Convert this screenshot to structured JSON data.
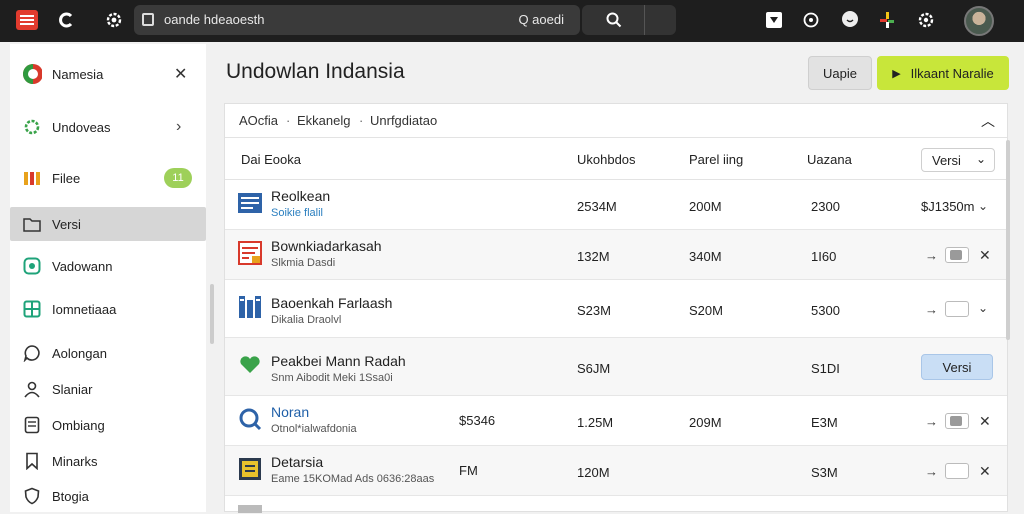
{
  "topbar": {
    "url_text": "oande hdeaoesth",
    "search_text": "Q aoedi",
    "icons": [
      "menu-icon",
      "refresh-icon",
      "gear-icon",
      "tab-icon",
      "search-icon",
      "download-icon",
      "whatsapp-icon",
      "emoji-icon",
      "pinwheel-icon",
      "settings-icon",
      "avatar"
    ]
  },
  "sidebar": {
    "header": "Namesia",
    "items": [
      {
        "label": "Undoveas",
        "icon": "gear-green-icon"
      },
      {
        "label": "Filee",
        "icon": "files-icon",
        "badge": "11"
      },
      {
        "label": "Versi",
        "icon": "folder-icon",
        "active": true
      },
      {
        "label": "Vadowann",
        "icon": "record-icon"
      },
      {
        "label": "Iomnetiaaa",
        "icon": "grid-icon"
      },
      {
        "label": "Aolongan",
        "icon": "chat-icon"
      },
      {
        "label": "Slaniar",
        "icon": "person-icon"
      },
      {
        "label": "Ombiang",
        "icon": "doc-icon"
      },
      {
        "label": "Minarks",
        "icon": "bookmark-icon"
      },
      {
        "label": "Btogia",
        "icon": "shield-icon"
      }
    ]
  },
  "main": {
    "title": "Undowlan Indansia",
    "btn_secondary": "Uapie",
    "btn_primary": "Ilkaant Naralie",
    "breadcrumbs": [
      "AOcfia",
      "Ekkanelg",
      "Unrfgdiatao"
    ],
    "columns": [
      "Dai Eooka",
      "Ukohbdos",
      "Parel iing",
      "Uazana",
      "Versi"
    ],
    "rows": [
      {
        "name": "Reolkean",
        "sub": "Soikie flalil",
        "sub_blue": true,
        "size": "",
        "c1": "2534M",
        "c2": "200M",
        "c3": "2300",
        "c4": "$J1350m",
        "action": "chevron",
        "icon": "doc-blue-icon"
      },
      {
        "name": "Bownkiadarkasah",
        "sub": "Slkmia Dasdi",
        "sub_blue": false,
        "size": "",
        "c1": "132M",
        "c2": "340M",
        "c3": "1I60",
        "c4": "",
        "action": "toggle-on",
        "icon": "box-red-icon"
      },
      {
        "name": "Baoenkah Farlaash",
        "sub": "Dikalia Draolvl",
        "sub_blue": false,
        "size": "",
        "c1": "S23M",
        "c2": "S20M",
        "c3": "5300",
        "c4": "",
        "action": "toggle-off-chevron",
        "icon": "building-blue-icon"
      },
      {
        "name": "Peakbei Mann Radah",
        "sub": "Snm Aibodit Meki 1Ssa0i",
        "sub_blue": false,
        "size": "",
        "c1": "S6JM",
        "c2": "",
        "c3": "S1DI",
        "c4": "",
        "action": "versi-button",
        "icon": "heart-green-icon"
      },
      {
        "name": "Noran",
        "sub": "Otnol*ialwafdonia",
        "sub_blue": false,
        "size": "$5346",
        "c1": "1.25M",
        "c2": "209M",
        "c3": "E3M",
        "c4": "",
        "action": "toggle-on",
        "icon": "q-blue-icon"
      },
      {
        "name": "Detarsia",
        "sub": "Eame 15KOMad Ads 0636:28aas",
        "sub_blue": false,
        "size": "FM",
        "c1": "120M",
        "c2": "",
        "c3": "S3M",
        "c4": "",
        "action": "toggle-off",
        "icon": "board-yellow-icon"
      }
    ],
    "versi_button": "Versi"
  }
}
